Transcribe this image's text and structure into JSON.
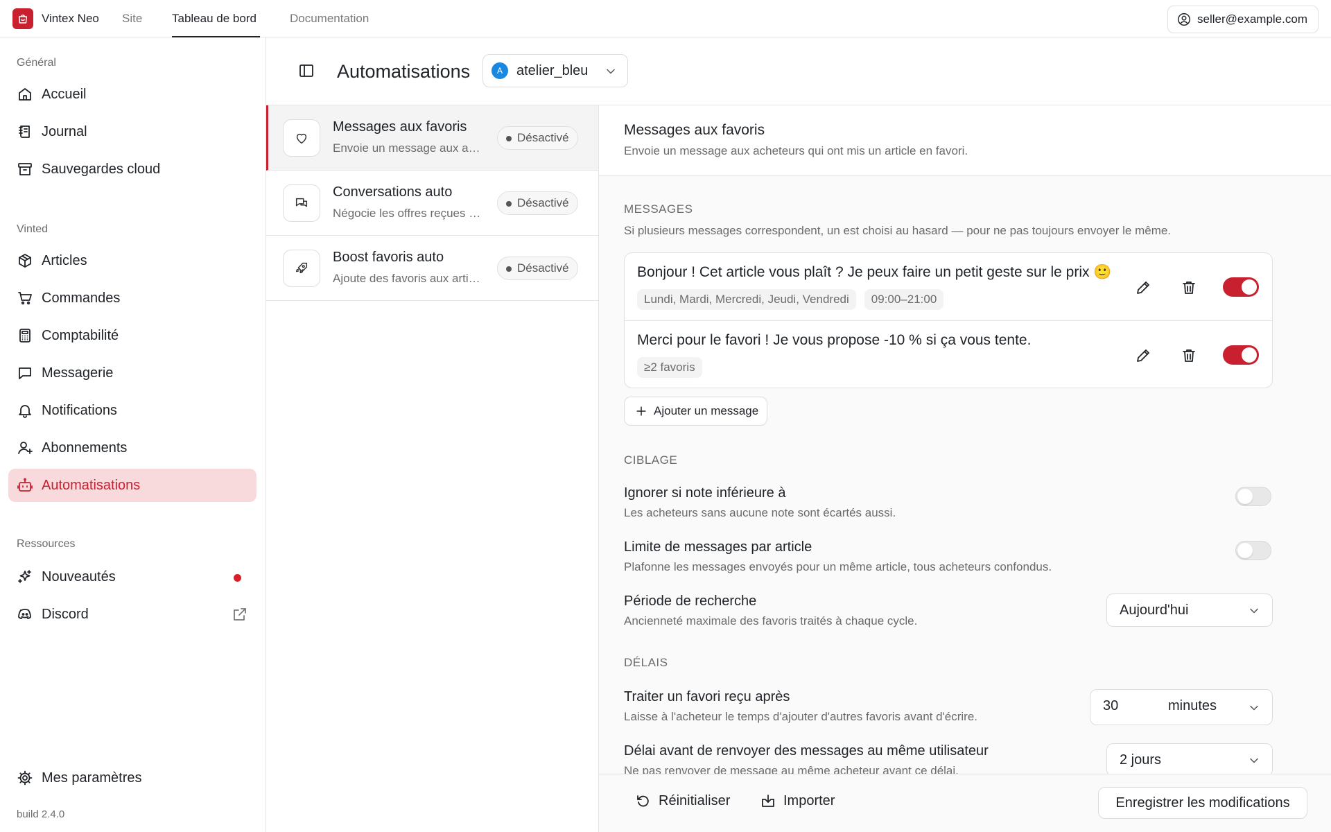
{
  "topbar": {
    "brand": "Vintex Neo",
    "nav": [
      "Site",
      "Tableau de bord",
      "Documentation"
    ],
    "account_email": "seller@example.com"
  },
  "sidebar": {
    "section_general": "Général",
    "general": [
      "Accueil",
      "Journal",
      "Sauvegardes cloud"
    ],
    "section_vinted": "Vinted",
    "vinted": [
      "Articles",
      "Commandes",
      "Comptabilité",
      "Messagerie",
      "Notifications",
      "Abonnements",
      "Automatisations"
    ],
    "section_resources": "Ressources",
    "resources": [
      "Nouveautés",
      "Discord"
    ],
    "settings": "Mes paramètres",
    "build": "build 2.4.0"
  },
  "header": {
    "title": "Automatisations",
    "account_initial": "A",
    "account_name": "atelier_bleu"
  },
  "automations": [
    {
      "title": "Messages aux favoris",
      "desc": "Envoie un message aux acheteurs qui ont mis un article en favori.",
      "status": "Désactivé",
      "icon": "heart-icon"
    },
    {
      "title": "Conversations auto",
      "desc": "Négocie les offres reçues automatiquement.",
      "status": "Désactivé",
      "icon": "chat-icon"
    },
    {
      "title": "Boost favoris auto",
      "desc": "Ajoute des favoris aux articles automatiquement.",
      "status": "Désactivé",
      "icon": "rocket-icon"
    }
  ],
  "detail": {
    "title": "Messages aux favoris",
    "subtitle": "Envoie un message aux acheteurs qui ont mis un article en favori.",
    "messages_label": "MESSAGES",
    "messages_help": "Si plusieurs messages correspondent, un est choisi au hasard — pour ne pas toujours envoyer le même.",
    "messages": [
      {
        "text": "Bonjour ! Cet article vous plaît ? Je peux faire un petit geste sur le prix 🙂",
        "chips": [
          "Lundi, Mardi, Mercredi, Jeudi, Vendredi",
          "09:00–21:00"
        ],
        "enabled": true
      },
      {
        "text": "Merci pour le favori ! Je vous propose -10 % si ça vous tente.",
        "chips": [
          "≥2 favoris"
        ],
        "enabled": true
      }
    ],
    "add_message": "Ajouter un message",
    "targeting_label": "CIBLAGE",
    "ignore_title": "Ignorer si note inférieure à",
    "ignore_help": "Les acheteurs sans aucune note sont écartés aussi.",
    "ignore_enabled": false,
    "limit_title": "Limite de messages par article",
    "limit_help": "Plafonne les messages envoyés pour un même article, tous acheteurs confondus.",
    "limit_enabled": false,
    "period_title": "Période de recherche",
    "period_help": "Ancienneté maximale des favoris traités à chaque cycle.",
    "period_value": "Aujourd'hui",
    "delays_label": "DÉLAIS",
    "process_title": "Traiter un favori reçu après",
    "process_help": "Laisse à l'acheteur le temps d'ajouter d'autres favoris avant d'écrire.",
    "process_value": "30",
    "process_unit": "minutes",
    "resend_title": "Délai avant de renvoyer des messages au même utilisateur",
    "resend_help": "Ne pas renvoyer de message au même acheteur avant ce délai.",
    "resend_value": "2 jours"
  },
  "footer": {
    "reset": "Réinitialiser",
    "import": "Importer",
    "save": "Enregistrer les modifications"
  },
  "colors": {
    "accent": "#c8202f",
    "active_bg": "#f8dadd",
    "avatar": "#1a88e0"
  }
}
